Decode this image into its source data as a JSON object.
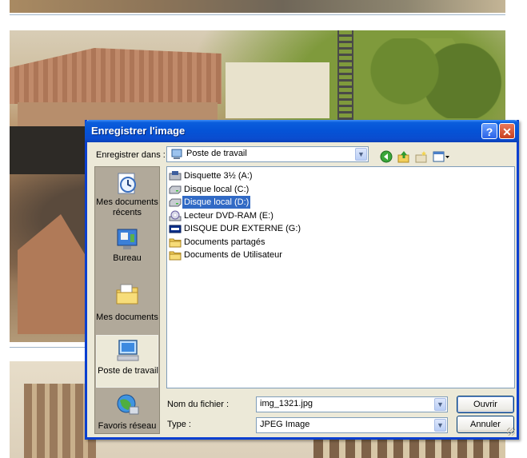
{
  "dialog": {
    "title": "Enregistrer l'image",
    "help_glyph": "?",
    "close_glyph": "✕",
    "save_in_label": "Enregistrer dans :",
    "save_in_value": "Poste de travail",
    "toolbar_icons": [
      "back-icon",
      "up-folder-icon",
      "new-folder-icon",
      "views-menu-icon"
    ],
    "places": [
      {
        "label": "Mes documents récents",
        "icon": "recent-documents-icon"
      },
      {
        "label": "Bureau",
        "icon": "desktop-icon"
      },
      {
        "label": "Mes documents",
        "icon": "my-documents-icon"
      },
      {
        "label": "Poste de travail",
        "icon": "my-computer-icon",
        "selected": true
      },
      {
        "label": "Favoris réseau",
        "icon": "network-places-icon"
      }
    ],
    "files": [
      {
        "label": "Disquette 3½ (A:)",
        "icon": "floppy-drive-icon"
      },
      {
        "label": "Disque local (C:)",
        "icon": "hard-drive-icon"
      },
      {
        "label": "Disque local (D:)",
        "icon": "hard-drive-icon",
        "selected": true
      },
      {
        "label": "Lecteur DVD-RAM (E:)",
        "icon": "dvd-drive-icon"
      },
      {
        "label": "DISQUE DUR EXTERNE (G:)",
        "icon": "external-drive-icon"
      },
      {
        "label": "Documents partagés",
        "icon": "shared-folder-icon"
      },
      {
        "label": "Documents de Utilisateur",
        "icon": "folder-icon"
      }
    ],
    "filename_label": "Nom du fichier :",
    "filename_value": "img_1321.jpg",
    "type_label": "Type :",
    "type_value": "JPEG Image",
    "save_button": "Ouvrir",
    "cancel_button": "Annuler",
    "colors": {
      "titlebar": "#0553d6",
      "selection": "#316ac5",
      "places_bar": "#b1a99a"
    }
  }
}
